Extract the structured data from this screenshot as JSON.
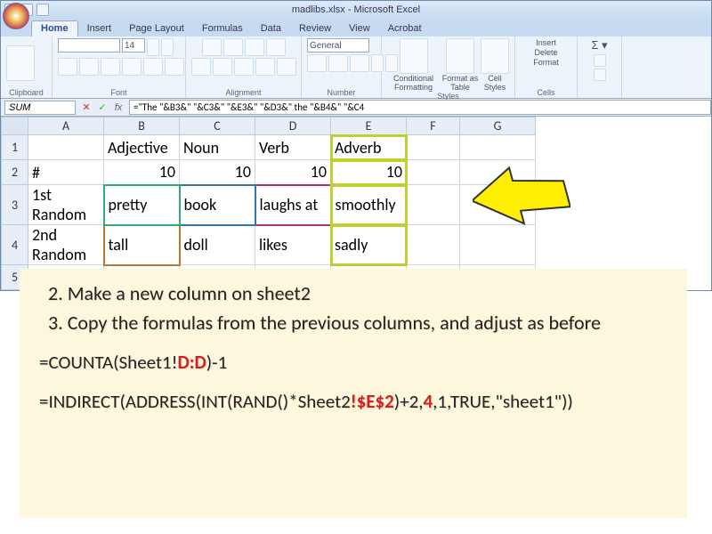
{
  "window": {
    "title": "madlibs.xlsx - Microsoft Excel"
  },
  "tabs": [
    "Home",
    "Insert",
    "Page Layout",
    "Formulas",
    "Data",
    "Review",
    "View",
    "Acrobat"
  ],
  "ribbon": {
    "font_name": "",
    "font_size": "14",
    "number_format": "General",
    "groups": [
      "Clipboard",
      "Font",
      "Alignment",
      "Number",
      "Styles",
      "Cells"
    ],
    "styles": {
      "cf": "Conditional Formatting",
      "fat": "Format as Table",
      "cs": "Cell Styles"
    },
    "cells": {
      "ins": "Insert",
      "del": "Delete",
      "fmt": "Format"
    }
  },
  "formula_bar": {
    "name_box": "SUM",
    "formula": "=\"The \"&B3&\" \"&C3&\" \"&E3&\" \"&D3&\" the \"&B4&\" \"&C4"
  },
  "sheet": {
    "cols": [
      "A",
      "B",
      "C",
      "D",
      "E",
      "F",
      "G"
    ],
    "rows": [
      {
        "n": "1",
        "cells": [
          "",
          "Adjective",
          "Noun",
          "Verb",
          "Adverb",
          "",
          ""
        ]
      },
      {
        "n": "2",
        "cells": [
          "#",
          "10",
          "10",
          "10",
          "10",
          "",
          ""
        ]
      },
      {
        "n": "3",
        "cells": [
          "1st Random",
          "pretty",
          "book",
          "laughs at",
          "smoothly",
          "",
          ""
        ]
      },
      {
        "n": "4",
        "cells": [
          "2nd Random",
          "tall",
          "doll",
          "likes",
          "sadly",
          "",
          ""
        ]
      },
      {
        "n": "5",
        "cells": [
          "",
          "",
          "",
          "",
          "",
          "",
          ""
        ]
      }
    ]
  },
  "instructions": {
    "step2": "Make a new column on sheet2",
    "step3": "Copy the formulas from the previous columns, and adjust as before",
    "f1_a": "=COUNTA(Sheet1!",
    "f1_b": "D:D",
    "f1_c": ")-1",
    "f2_a": "=INDIRECT(ADDRESS(INT(RAND()*Sheet2",
    "f2_b": "!$E$2",
    "f2_c": ")+2,",
    "f2_d": "4",
    "f2_e": ",1,TRUE,\"sheet1\"))"
  }
}
